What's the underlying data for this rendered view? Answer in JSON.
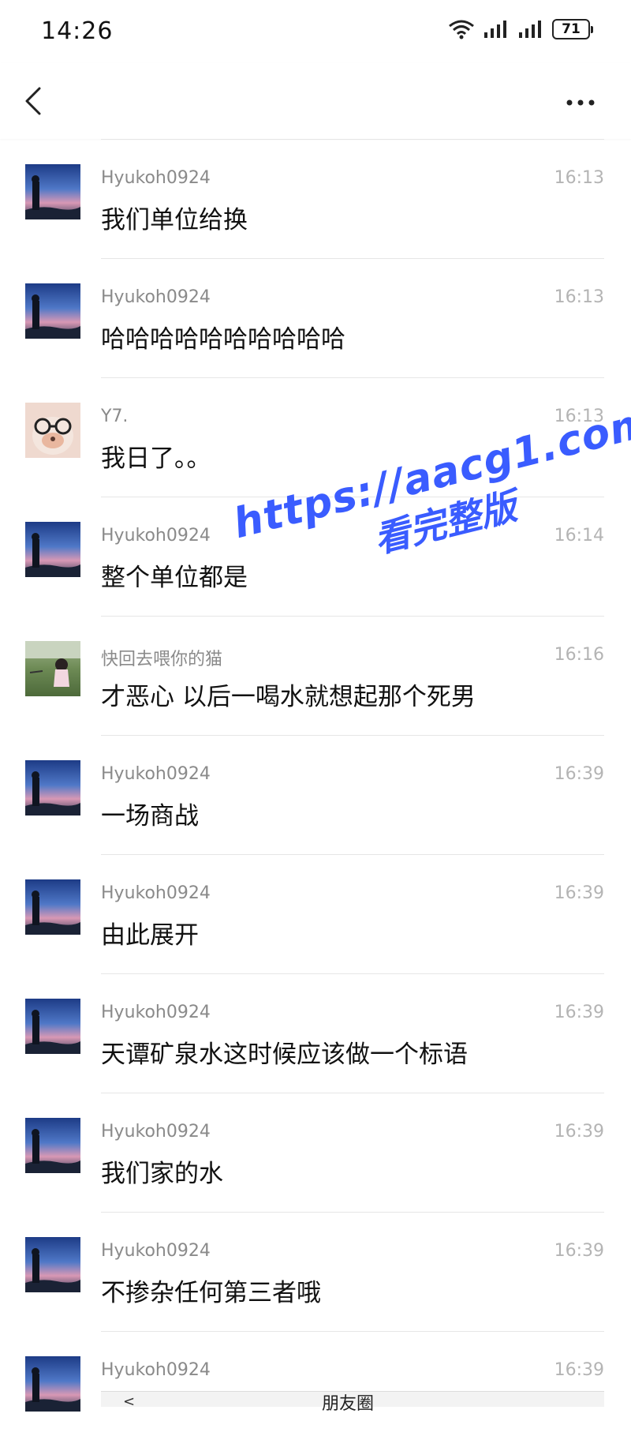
{
  "status_bar": {
    "time": "14:26",
    "battery": "71"
  },
  "nav": {
    "back_icon": "chevron-left-icon",
    "more_icon": "more-dots-icon"
  },
  "messages": [
    {
      "name": "Hyukoh0924",
      "time": "16:13",
      "text": "我们单位给换",
      "avatar": "night-sky-figure"
    },
    {
      "name": "Hyukoh0924",
      "time": "16:13",
      "text": "哈哈哈哈哈哈哈哈哈哈",
      "avatar": "night-sky-figure"
    },
    {
      "name": "Y7.",
      "time": "16:13",
      "text": "我日了。。",
      "avatar": "dog-with-glasses"
    },
    {
      "name": "Hyukoh0924",
      "time": "16:14",
      "text": "整个单位都是",
      "avatar": "night-sky-figure"
    },
    {
      "name": "快回去喂你的猫",
      "time": "16:16",
      "text": "才恶心 以后一喝水就想起那个死男",
      "avatar": "girl-in-park"
    },
    {
      "name": "Hyukoh0924",
      "time": "16:39",
      "text": "一场商战",
      "avatar": "night-sky-figure"
    },
    {
      "name": "Hyukoh0924",
      "time": "16:39",
      "text": "由此展开",
      "avatar": "night-sky-figure"
    },
    {
      "name": "Hyukoh0924",
      "time": "16:39",
      "text": "天谭矿泉水这时候应该做一个标语",
      "avatar": "night-sky-figure"
    },
    {
      "name": "Hyukoh0924",
      "time": "16:39",
      "text": "我们家的水",
      "avatar": "night-sky-figure"
    },
    {
      "name": "Hyukoh0924",
      "time": "16:39",
      "text": "不掺杂任何第三者哦",
      "avatar": "night-sky-figure"
    },
    {
      "name": "Hyukoh0924",
      "time": "16:39",
      "text": "",
      "avatar": "night-sky-figure"
    }
  ],
  "bottom_snippet": {
    "back": "<",
    "title": "朋友圈"
  },
  "watermark": {
    "line1": "https://aacg1.com",
    "line2": "看完整版",
    "color": "#3a5cff"
  }
}
